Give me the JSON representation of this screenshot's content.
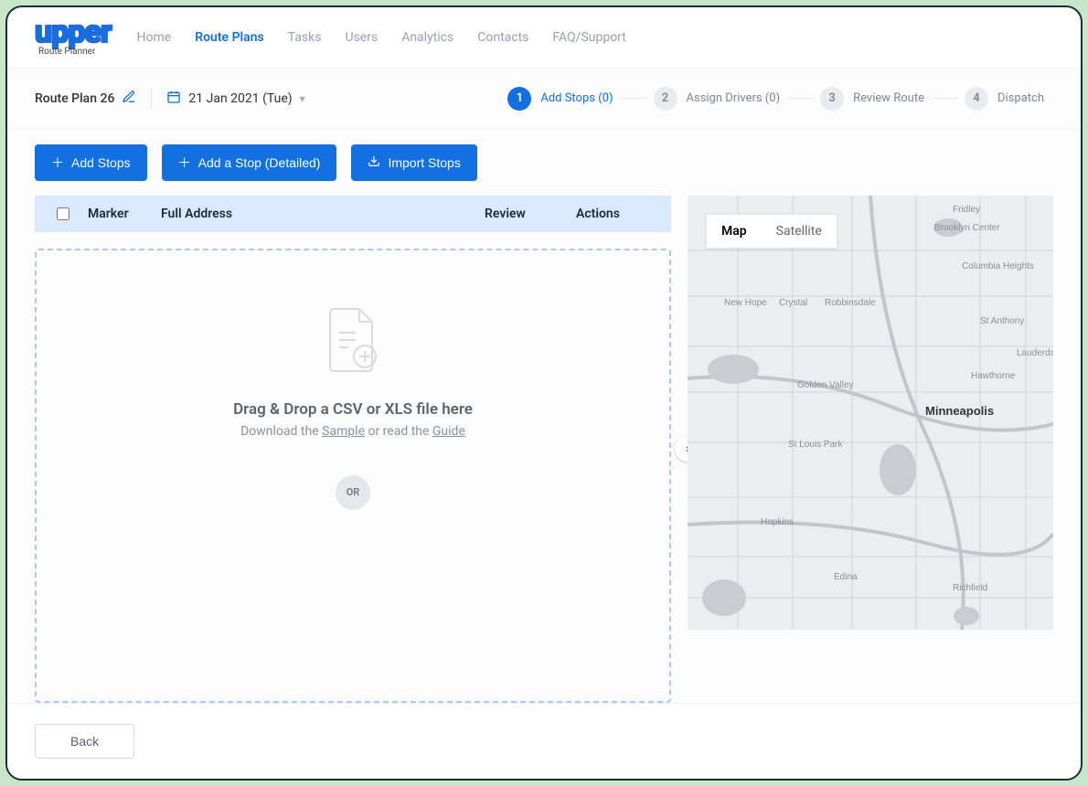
{
  "brand": {
    "name": "upper",
    "tagline": "Route Planner"
  },
  "nav": {
    "items": [
      {
        "label": "Home",
        "active": false
      },
      {
        "label": "Route Plans",
        "active": true
      },
      {
        "label": "Tasks",
        "active": false
      },
      {
        "label": "Users",
        "active": false
      },
      {
        "label": "Analytics",
        "active": false
      },
      {
        "label": "Contacts",
        "active": false
      },
      {
        "label": "FAQ/Support",
        "active": false
      }
    ]
  },
  "plan": {
    "name": "Route Plan 26",
    "date": "21 Jan 2021 (Tue)"
  },
  "stepper": [
    {
      "num": "1",
      "label": "Add Stops (0)",
      "active": true
    },
    {
      "num": "2",
      "label": "Assign Drivers (0)",
      "active": false
    },
    {
      "num": "3",
      "label": "Review Route",
      "active": false
    },
    {
      "num": "4",
      "label": "Dispatch",
      "active": false
    }
  ],
  "buttons": {
    "add_stops": "Add Stops",
    "add_detailed": "Add a Stop (Detailed)",
    "import": "Import Stops",
    "back": "Back"
  },
  "table": {
    "col_marker": "Marker",
    "col_address": "Full Address",
    "col_review": "Review",
    "col_actions": "Actions"
  },
  "dropzone": {
    "title": "Drag & Drop a CSV or XLS file here",
    "prefix": "Download the ",
    "sample": "Sample",
    "middle": " or read the ",
    "guide": "Guide",
    "or": "OR"
  },
  "map": {
    "toggle_map": "Map",
    "toggle_sat": "Satellite",
    "city_label": "Minneapolis",
    "labels": [
      "Fridley",
      "Brooklyn Center",
      "Columbia Heights",
      "New Hope",
      "Crystal",
      "Robbinsdale",
      "St Anthony",
      "Lauderdale",
      "Golden Valley",
      "St Louis Park",
      "Hopkins",
      "Edina",
      "Richfield",
      "Hawthorne"
    ]
  }
}
